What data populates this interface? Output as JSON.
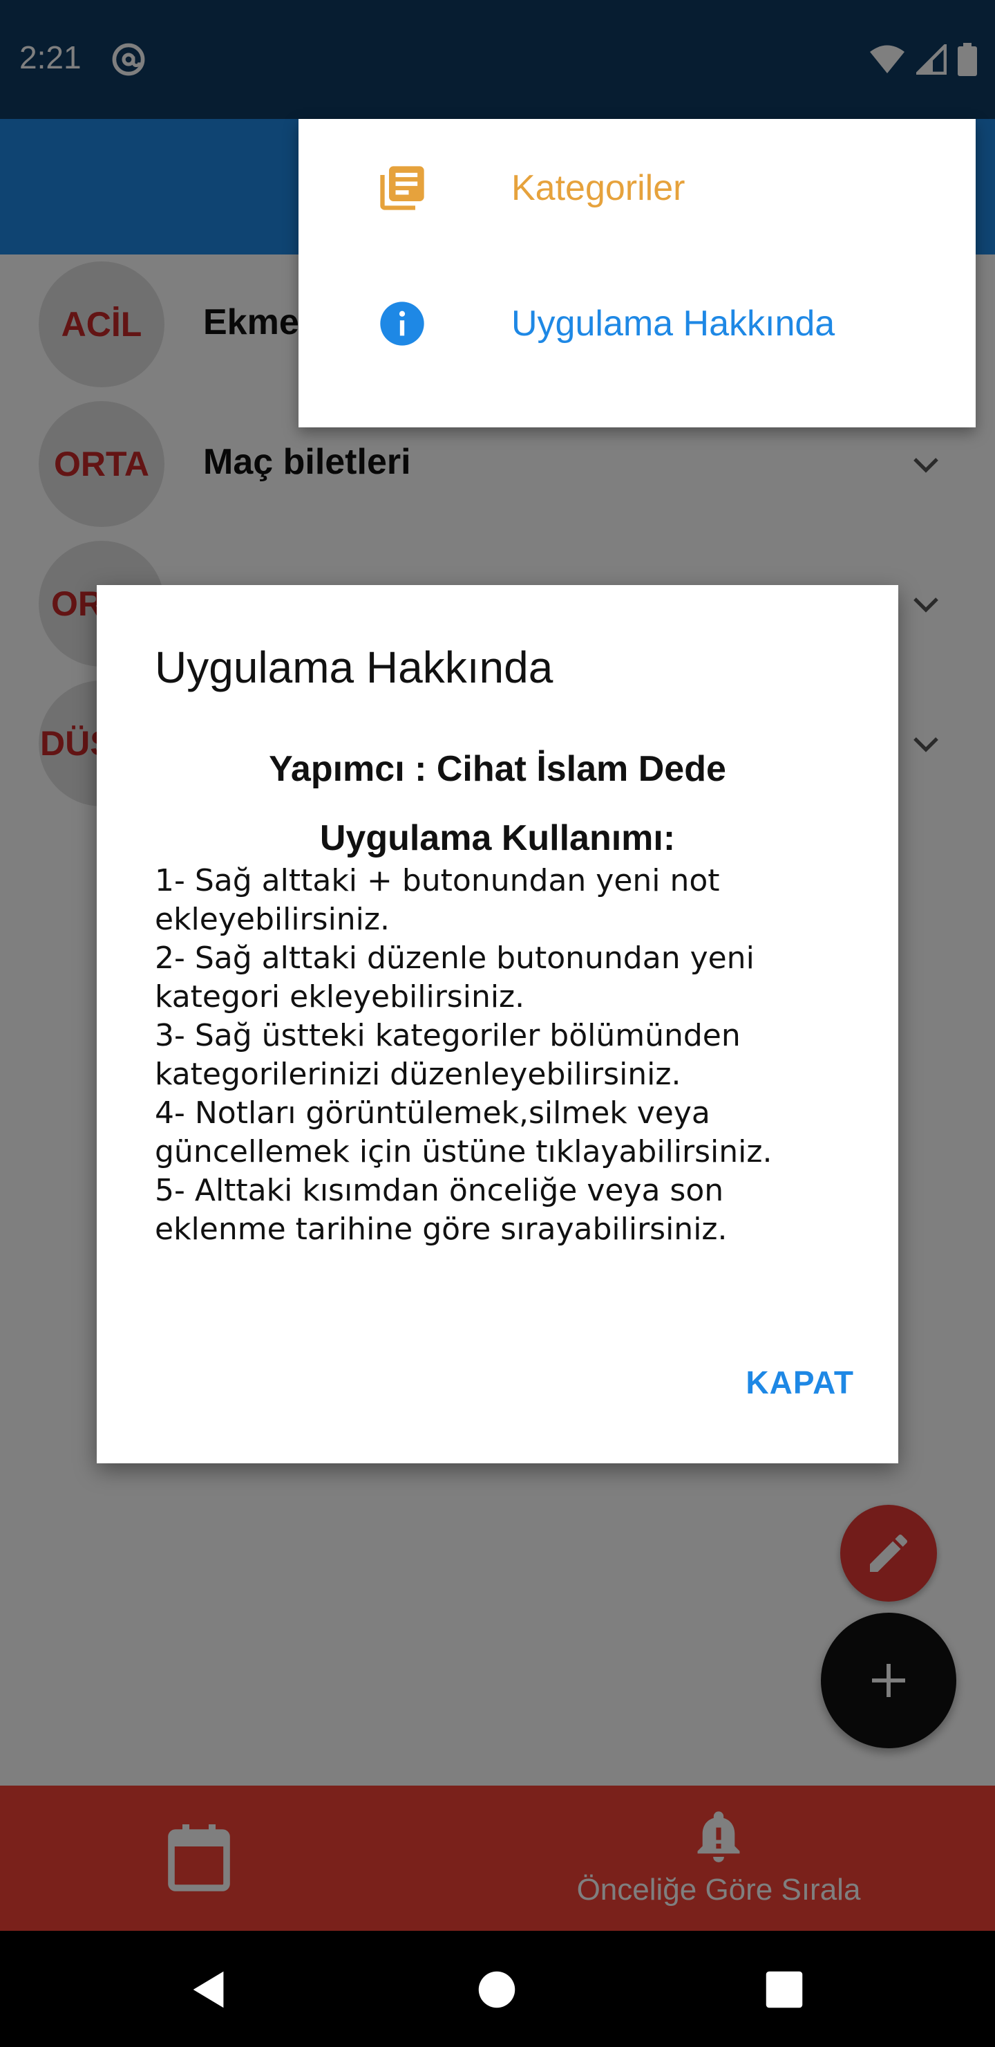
{
  "status_bar": {
    "time": "2:21"
  },
  "notes": [
    {
      "priority": "ACİL",
      "title": "Ekme"
    },
    {
      "priority": "ORTA",
      "title": "Maç biletleri"
    },
    {
      "priority": "OR",
      "title": ""
    },
    {
      "priority": "DÜŞ",
      "title": ""
    }
  ],
  "menu": {
    "items": [
      {
        "label": "Kategoriler",
        "icon": "library-books-icon",
        "color": "#e6a23c"
      },
      {
        "label": "Uygulama Hakkında",
        "icon": "info-icon",
        "color": "#1e88e5"
      }
    ]
  },
  "dialog": {
    "title": "Uygulama Hakkında",
    "maker": "Yapımcı : Cihat İslam Dede",
    "usage_title": "Uygulama Kullanımı:",
    "lines": [
      "1- Sağ alttaki + butonundan yeni not",
      "ekleyebilirsiniz.",
      "2- Sağ alttaki düzenle butonundan yeni",
      "kategori ekleyebilirsiniz.",
      "3- Sağ üstteki kategoriler bölümünden",
      "kategorilerinizi düzenleyebilirsiniz.",
      "4- Notları görüntülemek,silmek veya",
      "güncellemek için üstüne tıklayabilirsiniz.",
      "5- Alttaki kısımdan önceliğe veya son",
      "eklenme tarihine göre sırayabilirsiniz."
    ],
    "close_label": "KAPAT"
  },
  "bottom_nav": {
    "calendar_icon": "calendar-icon",
    "sort_label": "Önceliğe Göre Sırala",
    "sort_icon": "bell-alert-icon"
  },
  "colors": {
    "status_bar": "#0f3a63",
    "app_bar": "#1e88e5",
    "bottom_nav": "#f44336",
    "priority_text": "#c62828",
    "accent": "#1e88e5",
    "fab_edit": "#e53935"
  }
}
